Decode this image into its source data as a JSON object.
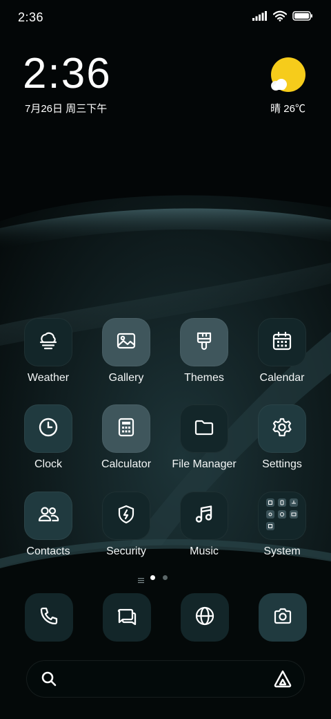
{
  "status_bar": {
    "time": "2:36",
    "icons": [
      "signal-icon",
      "wifi-icon",
      "battery-icon"
    ]
  },
  "clock_widget": {
    "time": "2:36",
    "date": "7月26日 周三下午"
  },
  "weather_widget": {
    "icon": "sun-cloud-icon",
    "summary": "晴 26℃"
  },
  "apps": [
    {
      "label": "Weather",
      "icon": "weather-icon"
    },
    {
      "label": "Gallery",
      "icon": "image-icon"
    },
    {
      "label": "Themes",
      "icon": "brush-icon"
    },
    {
      "label": "Calendar",
      "icon": "calendar-icon"
    },
    {
      "label": "Clock",
      "icon": "clock-icon"
    },
    {
      "label": "Calculator",
      "icon": "calculator-icon"
    },
    {
      "label": "File Manager",
      "icon": "folder-icon"
    },
    {
      "label": "Settings",
      "icon": "gear-icon"
    },
    {
      "label": "Contacts",
      "icon": "contacts-icon"
    },
    {
      "label": "Security",
      "icon": "shield-icon"
    },
    {
      "label": "Music",
      "icon": "music-icon"
    },
    {
      "label": "System",
      "icon": "folder-grid-icon"
    }
  ],
  "page_indicator": {
    "pages": 2,
    "current": 1
  },
  "dock": [
    {
      "name": "Phone",
      "icon": "phone-icon"
    },
    {
      "name": "Messages",
      "icon": "messages-icon"
    },
    {
      "name": "Browser",
      "icon": "globe-icon"
    },
    {
      "name": "Camera",
      "icon": "camera-icon"
    }
  ],
  "search_bar": {
    "icon": "search-icon",
    "assistant_icon": "assistant-icon"
  },
  "colors": {
    "accent_sun": "#f6cc1b",
    "icon_dark": "#132629",
    "icon_mid": "#203a3f",
    "icon_light": "#3f565c"
  }
}
